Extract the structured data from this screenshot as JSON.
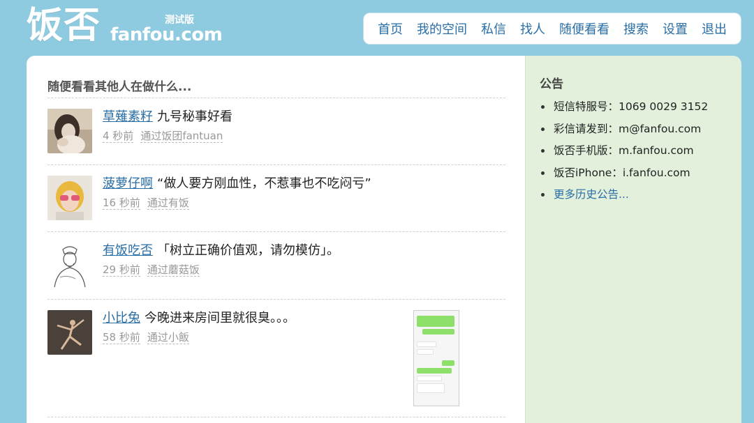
{
  "logo": {
    "cn": "饭否",
    "en": "fanfou.com",
    "beta": "测试版"
  },
  "nav": [
    "首页",
    "我的空间",
    "私信",
    "找人",
    "随便看看",
    "搜索",
    "设置",
    "退出"
  ],
  "main": {
    "title": "随便看看其他人在做什么...",
    "statuses": [
      {
        "user": "草薙素籽",
        "text": "九号秘事好看",
        "time": "4 秒前",
        "source": "通过饭团fantuan",
        "avatar": "avatar-girl-icon"
      },
      {
        "user": "菠萝仔啊",
        "text": "“做人要方刚血性，不惹事也不吃闷亏”",
        "time": "16 秒前",
        "source": "通过有饭",
        "avatar": "avatar-sunglasses-icon"
      },
      {
        "user": "有饭吃否",
        "text": "「树立正确价值观，请勿模仿」。",
        "time": "29 秒前",
        "source": "通过蘑菇饭",
        "avatar": "avatar-sketch-icon"
      },
      {
        "user": "小比兔",
        "text": "今晚进来房间里就很臭。。。",
        "time": "58 秒前",
        "source": "通过小飯",
        "avatar": "avatar-dancer-icon",
        "has_image": true
      }
    ]
  },
  "sidebar": {
    "title": "公告",
    "items": [
      "短信特服号：1069 0029 3152",
      "彩信请发到：m@fanfou.com",
      "饭否手机版：m.fanfou.com",
      "饭否iPhone：i.fanfou.com"
    ],
    "more": "更多历史公告..."
  },
  "colors": {
    "background": "#8fcbe0",
    "link": "#2a6ea6",
    "sidebar": "#e2f0dc"
  }
}
